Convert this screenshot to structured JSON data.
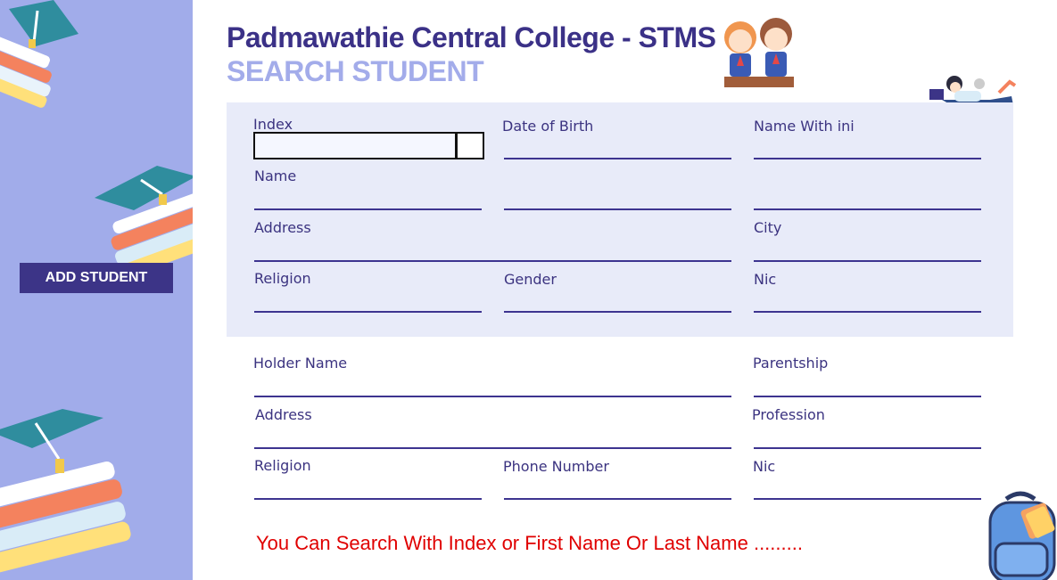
{
  "header": {
    "title": "Padmawathie Central College - STMS",
    "subtitle": "SEARCH STUDENT"
  },
  "sidebar": {
    "add_student_label": "ADD STUDENT"
  },
  "student": {
    "index_label": "Index",
    "index_value": "",
    "dob_label": "Date of Birth",
    "name_with_ini_label": "Name With ini",
    "name_label": "Name",
    "address_label": "Address",
    "city_label": "City",
    "religion_label": "Religion",
    "gender_label": "Gender",
    "nic_label": "Nic"
  },
  "guardian": {
    "holder_name_label": "Holder Name",
    "parentship_label": "Parentship",
    "address_label": "Address",
    "profession_label": "Profession",
    "religion_label": "Religion",
    "phone_label": "Phone Number",
    "nic_label": "Nic"
  },
  "hint": "You Can Search With Index or First Name Or Last Name ........."
}
